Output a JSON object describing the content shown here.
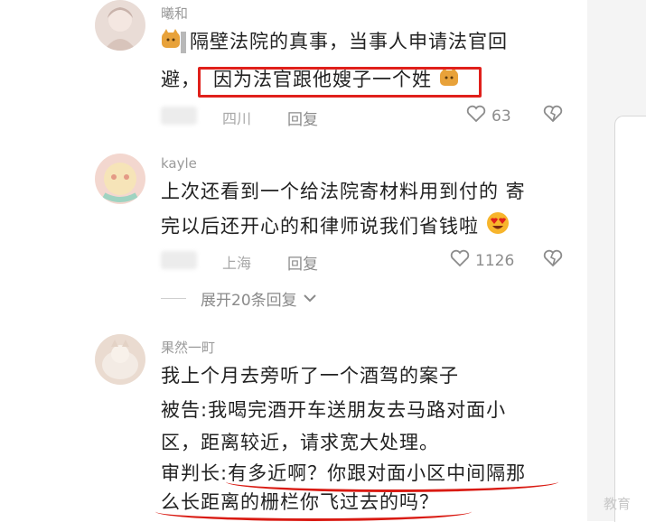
{
  "comments": [
    {
      "username": "曦和",
      "line1": "隔壁法院的真事，当事人申请法官回",
      "line2_prefix": "避，",
      "line2_highlight": "因为法官跟他嫂子一个姓",
      "location": "四川",
      "reply_label": "回复",
      "likes": "63"
    },
    {
      "username": "kayle",
      "line1": "上次还看到一个给法院寄材料用到付的 寄",
      "line2": "完以后还开心的和律师说我们省钱啦",
      "location": "上海",
      "reply_label": "回复",
      "likes": "1126",
      "expand_label": "展开20条回复"
    },
    {
      "username": "果然一町",
      "line1": "我上个月去旁听了一个酒驾的案子",
      "line2": "被告:我喝完酒开车送朋友去马路对面小",
      "line3": "区，距离较近，请求宽大处理。",
      "line4_prefix": "审判长:",
      "line4_rest": "有多近啊？你跟对面小区中间隔那",
      "line5": "么长距离的栅栏你飞过去的吗？"
    }
  ],
  "watermark": "教育",
  "colors": {
    "highlight_red": "#e0201b",
    "text": "#222222",
    "meta": "#a8a8a8"
  },
  "icons": [
    "heart-icon",
    "dislike-heart-icon",
    "chevron-down-icon",
    "cat-emoji-icon",
    "heart-eyes-emoji-icon"
  ]
}
